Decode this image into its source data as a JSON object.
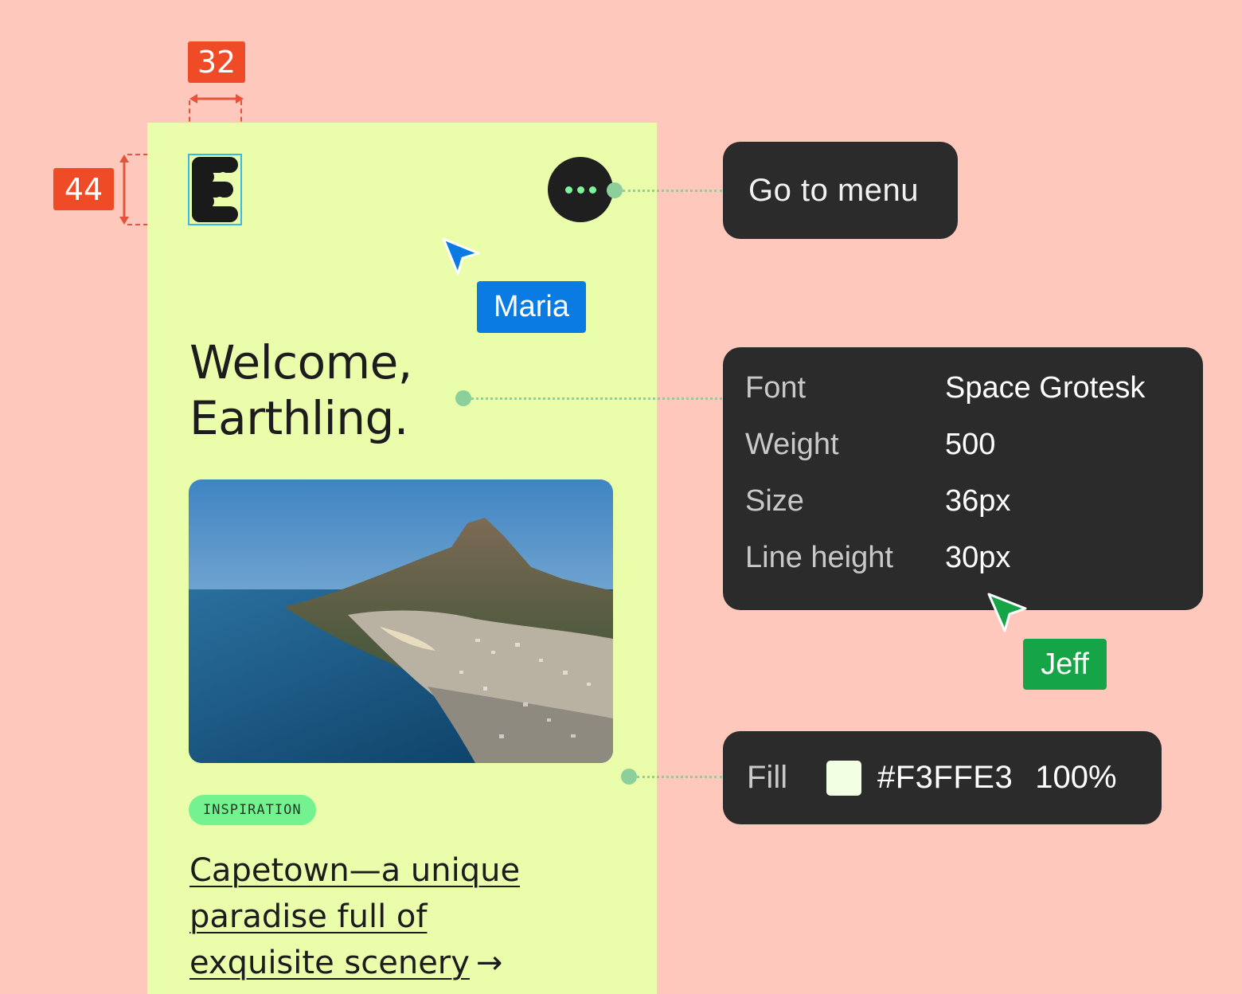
{
  "measurements": {
    "width_label": "32",
    "height_label": "44"
  },
  "app": {
    "welcome_line1": "Welcome,",
    "welcome_line2": "Earthling.",
    "tag": "INSPIRATION",
    "article_line1": "Capetown—a unique",
    "article_line2": "paradise full of",
    "article_line3": "exquisite scenery",
    "article_arrow": "→"
  },
  "cursors": {
    "maria": {
      "name": "Maria",
      "color": "#0B7BE4"
    },
    "jeff": {
      "name": "Jeff",
      "color": "#15A547"
    }
  },
  "menu_tooltip": {
    "label": "Go to menu"
  },
  "font_panel": {
    "rows": [
      {
        "key": "Font",
        "value": "Space Grotesk"
      },
      {
        "key": "Weight",
        "value": "500"
      },
      {
        "key": "Size",
        "value": "36px"
      },
      {
        "key": "Line height",
        "value": "30px"
      }
    ]
  },
  "fill_panel": {
    "label": "Fill",
    "hex": "#F3FFE3",
    "opacity": "100%",
    "swatch_color": "#F3FFE3"
  },
  "colors": {
    "background": "#FFC8BD",
    "frame": "#EAFDAB",
    "measure": "#EF4B26",
    "panel": "#2B2B2B",
    "tag": "#74F28F",
    "connector": "#8CCF9A"
  }
}
